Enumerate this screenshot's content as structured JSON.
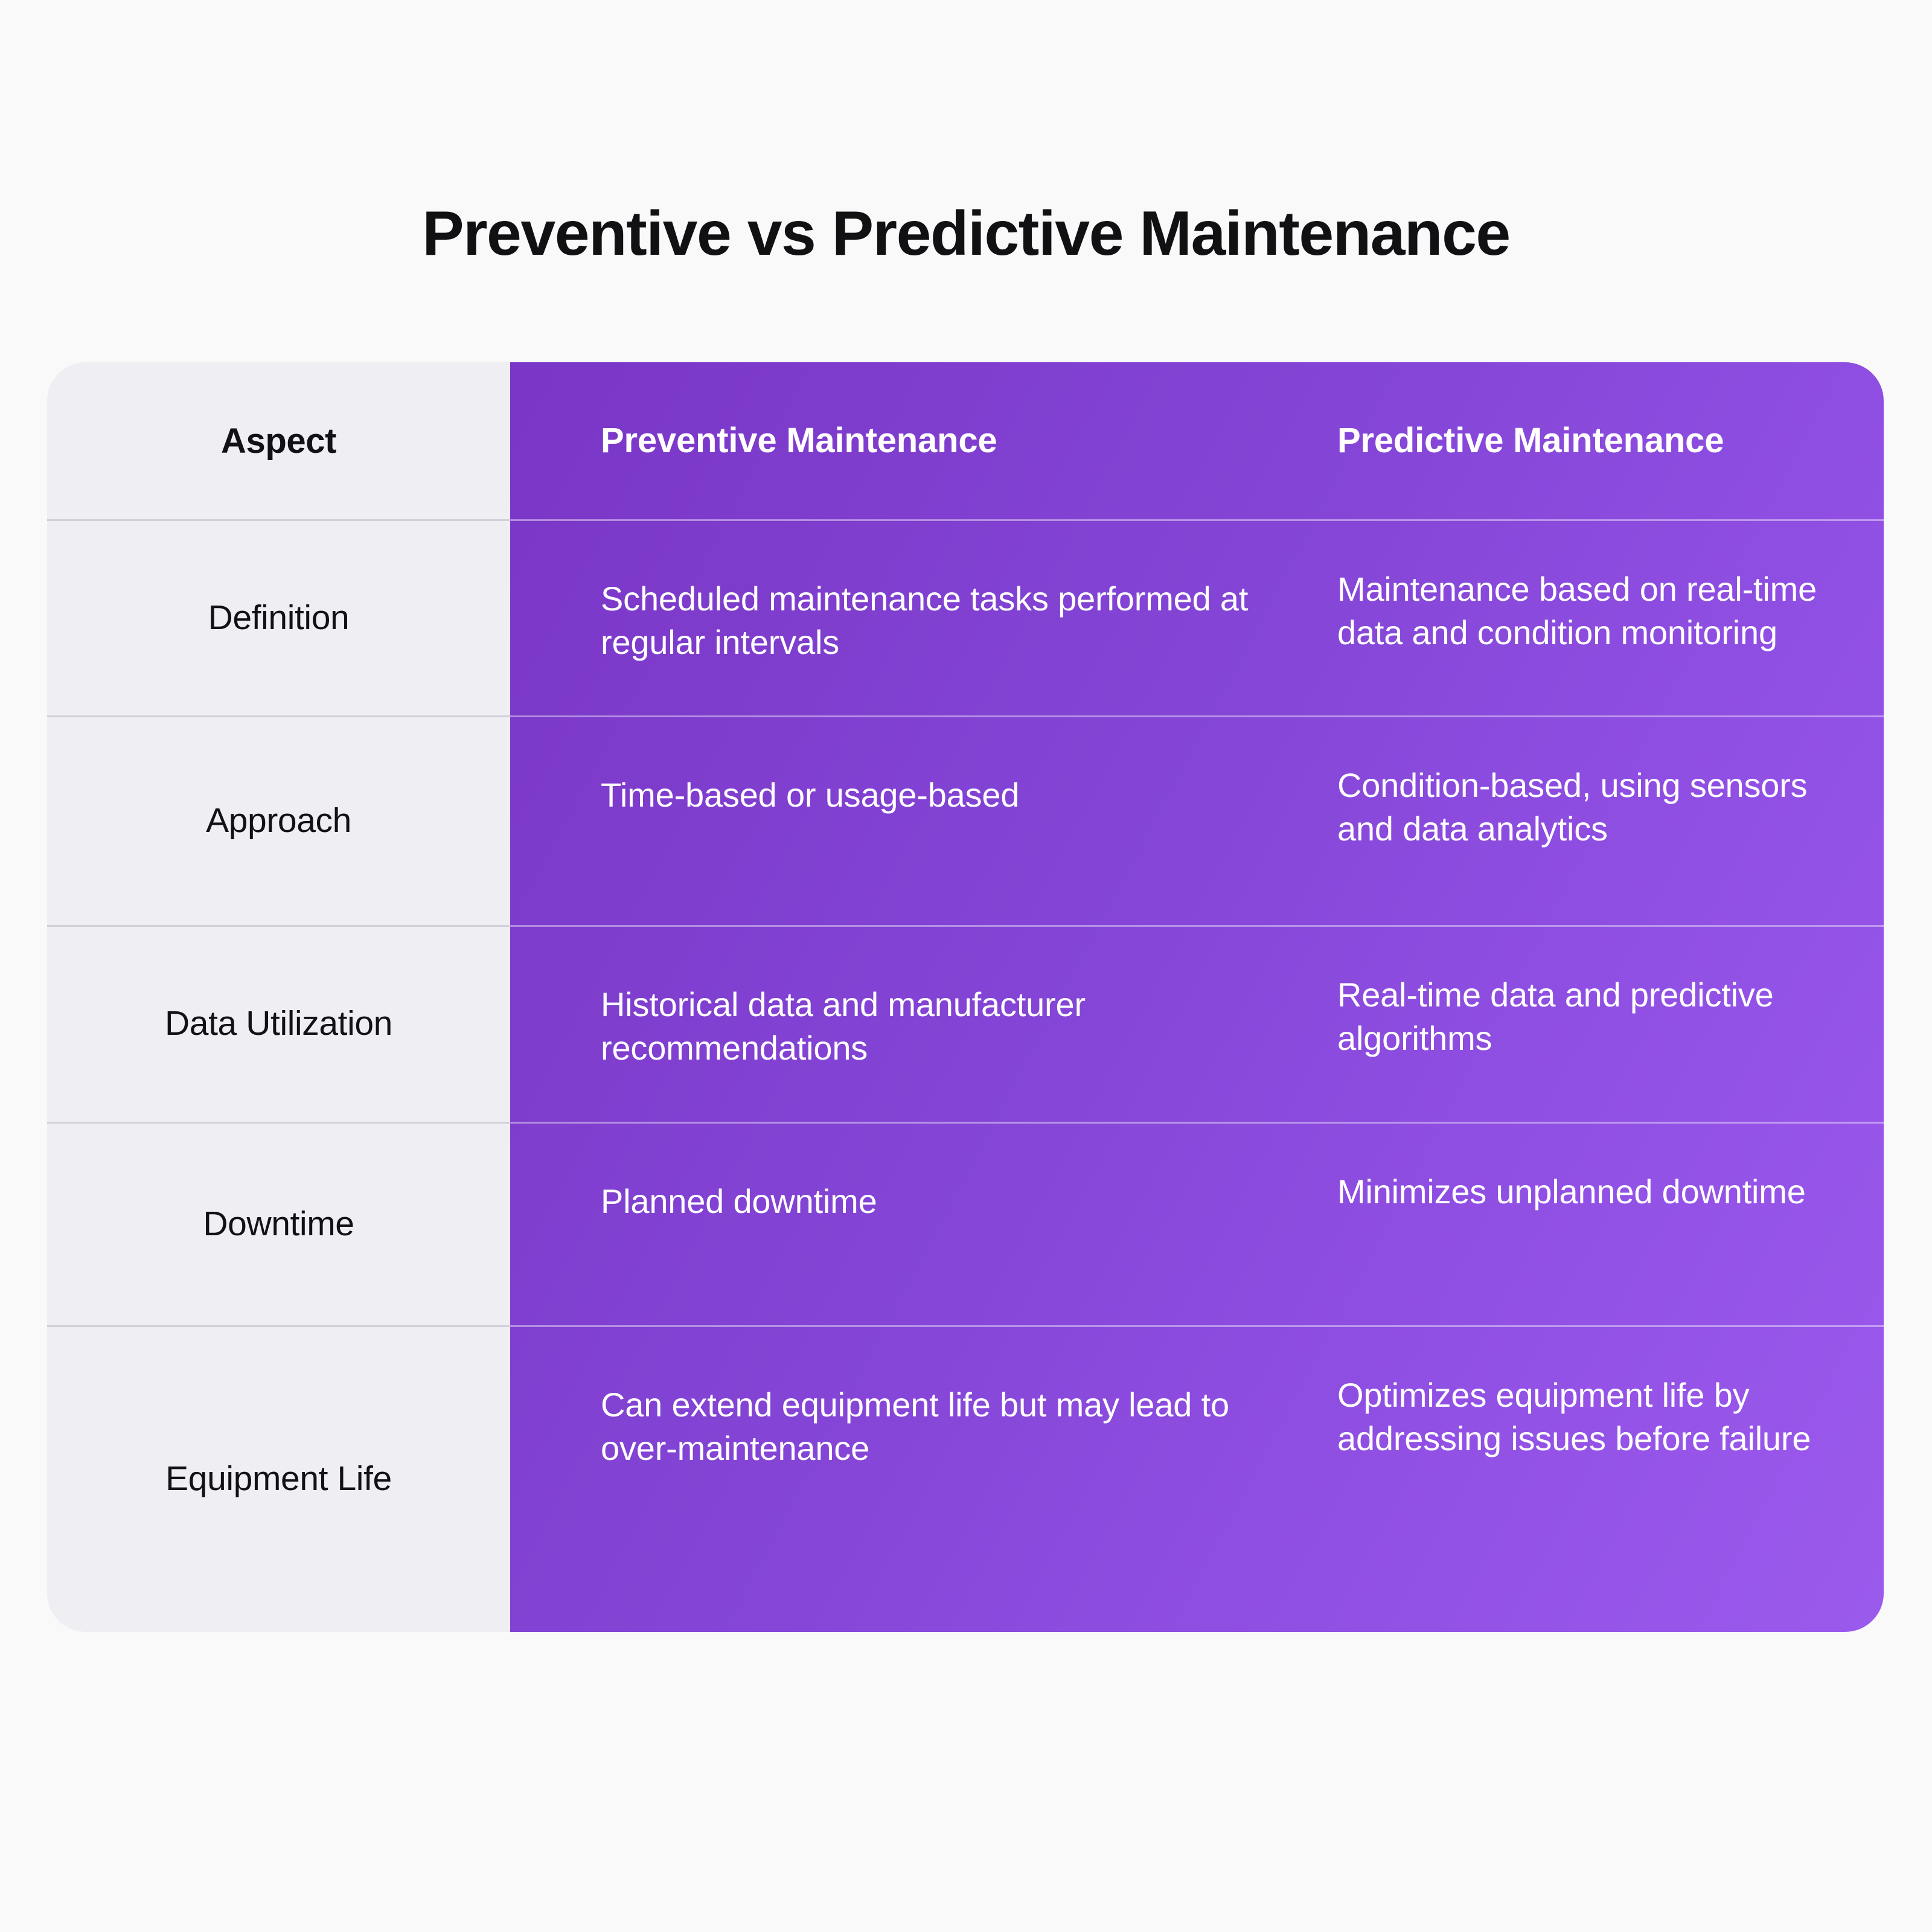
{
  "page": {
    "title": "Preventive vs Predictive Maintenance",
    "background_color": "#F9F9FA"
  },
  "theme": {
    "accent_purple_dark": "#7A36C6",
    "accent_purple_light": "#9B5AEC",
    "aspect_column_bg": "#EFEEF3",
    "title_color": "#111114",
    "purple_text_color": "#FFFFFF"
  },
  "table": {
    "columns": [
      {
        "key": "aspect",
        "label": "Aspect"
      },
      {
        "key": "preventive",
        "label": "Preventive Maintenance"
      },
      {
        "key": "predictive",
        "label": "Predictive Maintenance"
      }
    ],
    "rows": [
      {
        "aspect": "Definition",
        "preventive": "Scheduled maintenance tasks performed at regular intervals",
        "predictive": "Maintenance based on real-time data and condition monitoring"
      },
      {
        "aspect": "Approach",
        "preventive": "Time-based or usage-based",
        "predictive": "Condition-based, using sensors and data analytics"
      },
      {
        "aspect": "Data Utilization",
        "preventive": "Historical data and manufacturer recommendations",
        "predictive": "Real-time data and predictive algorithms"
      },
      {
        "aspect": "Downtime",
        "preventive": "Planned downtime",
        "predictive": "Minimizes unplanned downtime"
      },
      {
        "aspect": "Equipment Life",
        "preventive": "Can extend equipment life but may lead to over-maintenance",
        "predictive": "Optimizes equipment life by addressing issues before failure"
      }
    ]
  }
}
